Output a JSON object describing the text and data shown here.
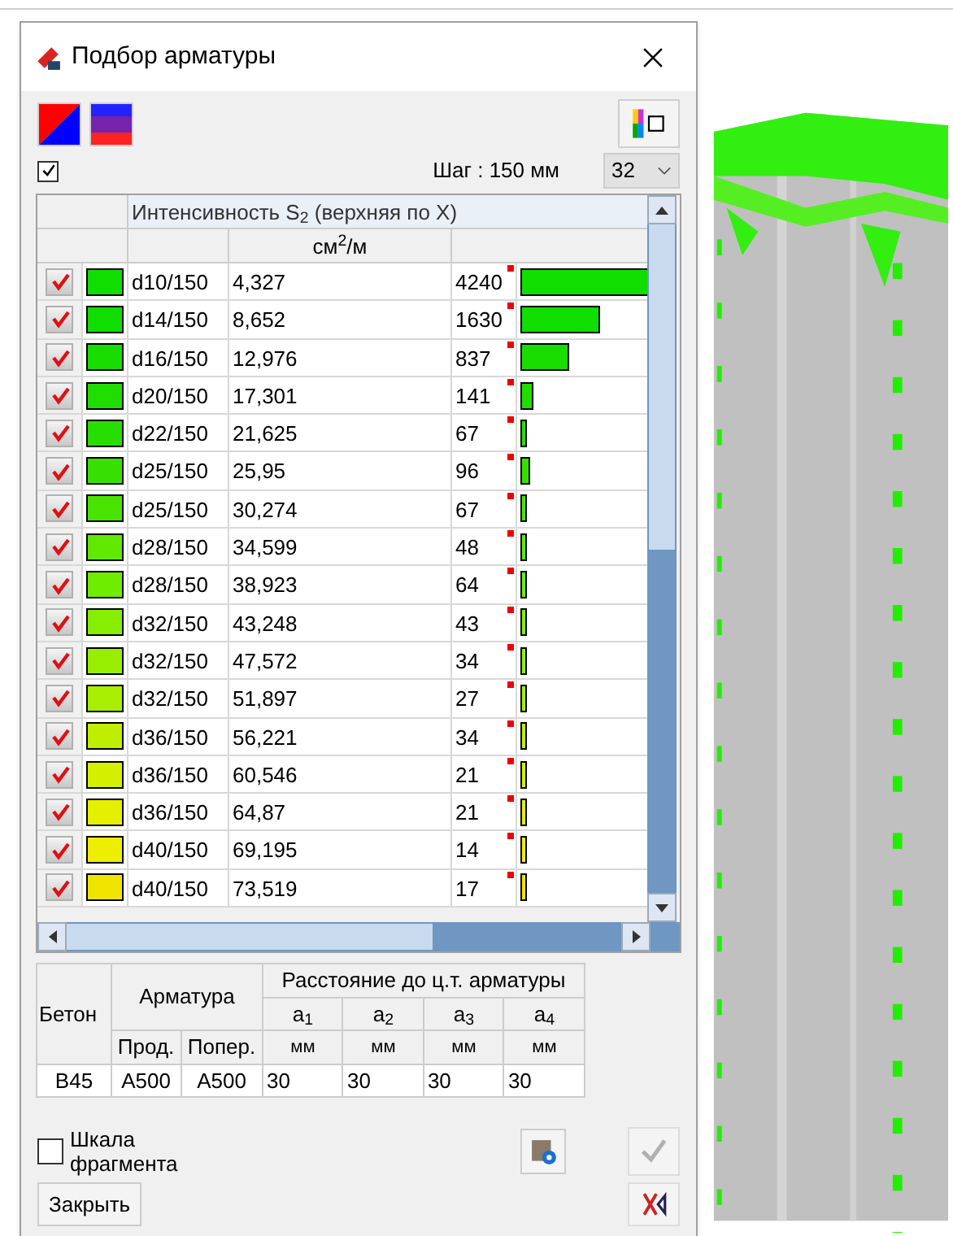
{
  "window": {
    "title": "Подбор арматуры"
  },
  "show_all": {
    "checked": true
  },
  "step": "Шаг : 150 мм",
  "count_select": {
    "value": "32"
  },
  "table": {
    "header": "Интенсивность S$_{2}$ (верхняя по X)",
    "unit": "см$^{2}$/м",
    "rows": [
      {
        "checked": true,
        "color": "#10dd00",
        "bar": "d10/150",
        "value": "4,327",
        "count": "4240"
      },
      {
        "checked": true,
        "color": "#10dd00",
        "bar": "d14/150",
        "value": "8,652",
        "count": "1630"
      },
      {
        "checked": true,
        "color": "#18dd00",
        "bar": "d16/150",
        "value": "12,976",
        "count": "837"
      },
      {
        "checked": true,
        "color": "#20dd00",
        "bar": "d20/150",
        "value": "17,301",
        "count": "141"
      },
      {
        "checked": true,
        "color": "#28dd00",
        "bar": "d22/150",
        "value": "21,625",
        "count": "67"
      },
      {
        "checked": true,
        "color": "#38e000",
        "bar": "d25/150",
        "value": "25,95",
        "count": "96"
      },
      {
        "checked": true,
        "color": "#48e400",
        "bar": "d25/150",
        "value": "30,274",
        "count": "67"
      },
      {
        "checked": true,
        "color": "#60e800",
        "bar": "d28/150",
        "value": "34,599",
        "count": "48"
      },
      {
        "checked": true,
        "color": "#70ec00",
        "bar": "d28/150",
        "value": "38,923",
        "count": "64"
      },
      {
        "checked": true,
        "color": "#88ee00",
        "bar": "d32/150",
        "value": "43,248",
        "count": "43"
      },
      {
        "checked": true,
        "color": "#98ee00",
        "bar": "d32/150",
        "value": "47,572",
        "count": "34"
      },
      {
        "checked": true,
        "color": "#a8ee00",
        "bar": "d32/150",
        "value": "51,897",
        "count": "27"
      },
      {
        "checked": true,
        "color": "#c0ee00",
        "bar": "d36/150",
        "value": "56,221",
        "count": "34"
      },
      {
        "checked": true,
        "color": "#d4f000",
        "bar": "d36/150",
        "value": "60,546",
        "count": "21"
      },
      {
        "checked": true,
        "color": "#e4f000",
        "bar": "d36/150",
        "value": "64,87",
        "count": "21"
      },
      {
        "checked": true,
        "color": "#eeee00",
        "bar": "d40/150",
        "value": "69,195",
        "count": "14"
      },
      {
        "checked": true,
        "color": "#eee400",
        "bar": "d40/150",
        "value": "73,519",
        "count": "17"
      }
    ]
  },
  "bottom_table": {
    "concrete": "Бетон",
    "rebar": "Арматура",
    "distance": "Расстояние до ц.т. арматуры",
    "a_labels": [
      "a$_{1}$",
      "a$_{2}$",
      "a$_{3}$",
      "a$_{4}$"
    ],
    "rebar_sub": [
      "Прод.",
      "Попер."
    ],
    "units": [
      "мм",
      "мм",
      "мм",
      "мм"
    ],
    "row": {
      "concrete": "B45",
      "long": "A500",
      "trans": "A500",
      "a": [
        "30",
        "30",
        "30",
        "30"
      ]
    }
  },
  "scale_fragment": {
    "label": "Шкала фрагмента",
    "checked": false
  },
  "close_button": "Закрыть"
}
